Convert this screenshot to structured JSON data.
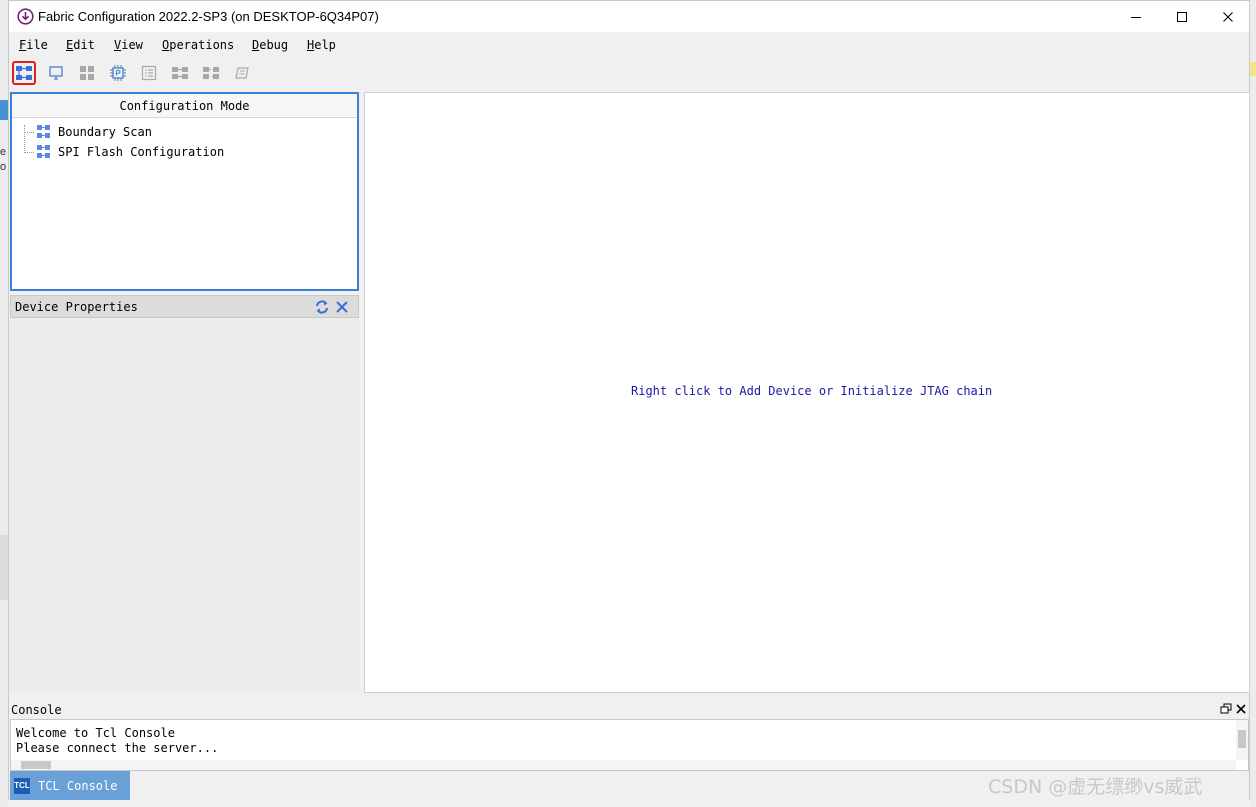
{
  "window": {
    "title": "Fabric Configuration 2022.2-SP3 (on DESKTOP-6Q34P07)"
  },
  "menu": [
    {
      "label": "File"
    },
    {
      "label": "Edit"
    },
    {
      "label": "View"
    },
    {
      "label": "Operations"
    },
    {
      "label": "Debug"
    },
    {
      "label": "Help"
    }
  ],
  "toolbar": {
    "buttons": [
      {
        "icon": "chain-icon",
        "active": true
      },
      {
        "icon": "monitor-icon",
        "active": false
      },
      {
        "icon": "grid-icon",
        "active": false
      },
      {
        "icon": "chip-icon",
        "active": false
      },
      {
        "icon": "list-icon",
        "active": false
      },
      {
        "icon": "connect-icon",
        "active": false
      },
      {
        "icon": "disconnect-icon",
        "active": false
      },
      {
        "icon": "erase-icon",
        "active": false
      }
    ]
  },
  "config_mode": {
    "title": "Configuration Mode",
    "items": [
      {
        "label": "Boundary Scan"
      },
      {
        "label": "SPI Flash Configuration"
      }
    ]
  },
  "device_properties": {
    "title": "Device Properties"
  },
  "canvas": {
    "hint": "Right click to Add Device or Initialize JTAG chain"
  },
  "console": {
    "label": "Console",
    "lines": [
      "Welcome to Tcl Console",
      "Please connect the server..."
    ]
  },
  "tabs": [
    {
      "badge": "TCL",
      "label": "TCL Console"
    }
  ],
  "watermark": "CSDN @虚无缥缈vs威武",
  "edge_text": [
    "e",
    "o"
  ],
  "colors": {
    "accent": "#3a82d8",
    "hint_text": "#1a1aa6",
    "highlight": "#e02020",
    "tab_active": "#6aa0d8"
  }
}
